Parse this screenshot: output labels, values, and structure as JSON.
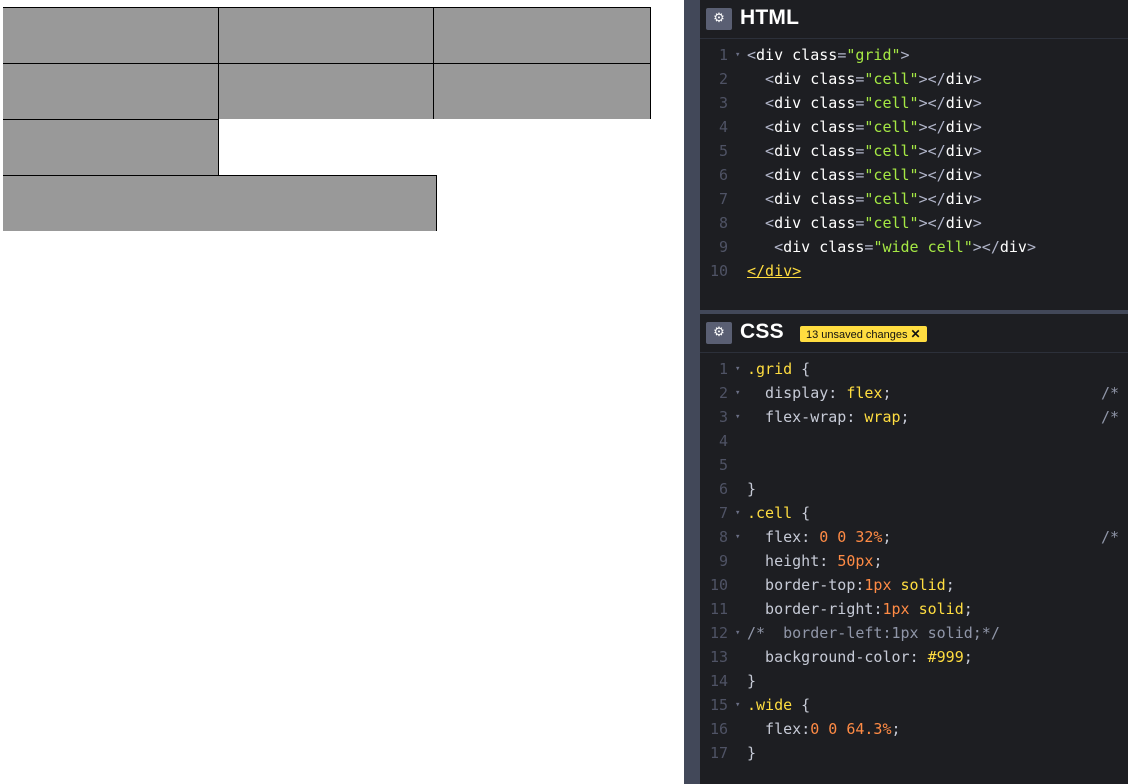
{
  "preview": {
    "rows": [
      [
        "",
        "",
        ""
      ],
      [
        "",
        "",
        ""
      ],
      [
        "",
        ""
      ]
    ]
  },
  "editors": {
    "html": {
      "title": "HTML",
      "lines": [
        {
          "n": "1",
          "fold": true,
          "tokens": [
            [
              "brk",
              "<"
            ],
            [
              "tag",
              "div "
            ],
            [
              "attr",
              "class"
            ],
            [
              "brk",
              "="
            ],
            [
              "str",
              "\"grid\""
            ],
            [
              "brk",
              ">"
            ]
          ]
        },
        {
          "n": "2",
          "tokens": [
            [
              "brk",
              "  <"
            ],
            [
              "tag",
              "div "
            ],
            [
              "attr",
              "class"
            ],
            [
              "brk",
              "="
            ],
            [
              "str",
              "\"cell\""
            ],
            [
              "brk",
              "></"
            ],
            [
              "tag",
              "div"
            ],
            [
              "brk",
              ">"
            ]
          ]
        },
        {
          "n": "3",
          "tokens": [
            [
              "brk",
              "  <"
            ],
            [
              "tag",
              "div "
            ],
            [
              "attr",
              "class"
            ],
            [
              "brk",
              "="
            ],
            [
              "str",
              "\"cell\""
            ],
            [
              "brk",
              "></"
            ],
            [
              "tag",
              "div"
            ],
            [
              "brk",
              ">"
            ]
          ]
        },
        {
          "n": "4",
          "tokens": [
            [
              "brk",
              "  <"
            ],
            [
              "tag",
              "div "
            ],
            [
              "attr",
              "class"
            ],
            [
              "brk",
              "="
            ],
            [
              "str",
              "\"cell\""
            ],
            [
              "brk",
              "></"
            ],
            [
              "tag",
              "div"
            ],
            [
              "brk",
              ">"
            ]
          ]
        },
        {
          "n": "5",
          "tokens": [
            [
              "brk",
              "  <"
            ],
            [
              "tag",
              "div "
            ],
            [
              "attr",
              "class"
            ],
            [
              "brk",
              "="
            ],
            [
              "str",
              "\"cell\""
            ],
            [
              "brk",
              "></"
            ],
            [
              "tag",
              "div"
            ],
            [
              "brk",
              ">"
            ]
          ]
        },
        {
          "n": "6",
          "tokens": [
            [
              "brk",
              "  <"
            ],
            [
              "tag",
              "div "
            ],
            [
              "attr",
              "class"
            ],
            [
              "brk",
              "="
            ],
            [
              "str",
              "\"cell\""
            ],
            [
              "brk",
              "></"
            ],
            [
              "tag",
              "div"
            ],
            [
              "brk",
              ">"
            ]
          ]
        },
        {
          "n": "7",
          "tokens": [
            [
              "brk",
              "  <"
            ],
            [
              "tag",
              "div "
            ],
            [
              "attr",
              "class"
            ],
            [
              "brk",
              "="
            ],
            [
              "str",
              "\"cell\""
            ],
            [
              "brk",
              "></"
            ],
            [
              "tag",
              "div"
            ],
            [
              "brk",
              ">"
            ]
          ]
        },
        {
          "n": "8",
          "tokens": [
            [
              "brk",
              "  <"
            ],
            [
              "tag",
              "div "
            ],
            [
              "attr",
              "class"
            ],
            [
              "brk",
              "="
            ],
            [
              "str",
              "\"cell\""
            ],
            [
              "brk",
              "></"
            ],
            [
              "tag",
              "div"
            ],
            [
              "brk",
              ">"
            ]
          ]
        },
        {
          "n": "9",
          "tokens": [
            [
              "brk",
              "   <"
            ],
            [
              "tag",
              "div "
            ],
            [
              "attr",
              "class"
            ],
            [
              "brk",
              "="
            ],
            [
              "str",
              "\"wide cell\""
            ],
            [
              "brk",
              "></"
            ],
            [
              "tag",
              "div"
            ],
            [
              "brk",
              ">"
            ]
          ]
        },
        {
          "n": "10",
          "tokens": [
            [
              "close",
              "</div>"
            ]
          ]
        }
      ]
    },
    "css": {
      "title": "CSS",
      "badge": "13 unsaved changes",
      "badge_close": "✕",
      "lines": [
        {
          "n": "1",
          "fold": true,
          "tokens": [
            [
              "selector",
              ".grid"
            ],
            [
              "prop",
              " {"
            ]
          ]
        },
        {
          "n": "2",
          "fold": true,
          "tokens": [
            [
              "prop",
              "  display"
            ],
            [
              "prop",
              ": "
            ],
            [
              "val",
              "flex"
            ],
            [
              "prop",
              ";"
            ]
          ],
          "trail": "/*"
        },
        {
          "n": "3",
          "fold": true,
          "tokens": [
            [
              "prop",
              "  flex-wrap"
            ],
            [
              "prop",
              ": "
            ],
            [
              "val",
              "wrap"
            ],
            [
              "prop",
              ";"
            ]
          ],
          "trail": "/*"
        },
        {
          "n": "4",
          "tokens": []
        },
        {
          "n": "5",
          "tokens": []
        },
        {
          "n": "6",
          "tokens": [
            [
              "prop",
              "}"
            ]
          ]
        },
        {
          "n": "7",
          "fold": true,
          "tokens": [
            [
              "selector",
              ".cell"
            ],
            [
              "prop",
              " {"
            ]
          ]
        },
        {
          "n": "8",
          "fold": true,
          "tokens": [
            [
              "prop",
              "  flex"
            ],
            [
              "prop",
              ": "
            ],
            [
              "num",
              "0 0 32%"
            ],
            [
              "prop",
              ";"
            ]
          ],
          "trail": "/*"
        },
        {
          "n": "9",
          "tokens": [
            [
              "prop",
              "  height"
            ],
            [
              "prop",
              ": "
            ],
            [
              "num",
              "50px"
            ],
            [
              "prop",
              ";"
            ]
          ]
        },
        {
          "n": "10",
          "tokens": [
            [
              "prop",
              "  border-top"
            ],
            [
              "prop",
              ":"
            ],
            [
              "num",
              "1px "
            ],
            [
              "val",
              "solid"
            ],
            [
              "prop",
              ";"
            ]
          ]
        },
        {
          "n": "11",
          "tokens": [
            [
              "prop",
              "  border-right"
            ],
            [
              "prop",
              ":"
            ],
            [
              "num",
              "1px "
            ],
            [
              "val",
              "solid"
            ],
            [
              "prop",
              ";"
            ]
          ]
        },
        {
          "n": "12",
          "fold": true,
          "tokens": [
            [
              "com",
              "/*  border-left:1px solid;*/"
            ]
          ]
        },
        {
          "n": "13",
          "tokens": [
            [
              "prop",
              "  background-color"
            ],
            [
              "prop",
              ": "
            ],
            [
              "val",
              "#999"
            ],
            [
              "prop",
              ";"
            ]
          ]
        },
        {
          "n": "14",
          "tokens": [
            [
              "prop",
              "}"
            ]
          ]
        },
        {
          "n": "15",
          "fold": true,
          "tokens": [
            [
              "selector",
              ".wide"
            ],
            [
              "prop",
              " {"
            ]
          ]
        },
        {
          "n": "16",
          "tokens": [
            [
              "prop",
              "  flex"
            ],
            [
              "prop",
              ":"
            ],
            [
              "num",
              "0 0 64.3%"
            ],
            [
              "prop",
              ";"
            ]
          ]
        },
        {
          "n": "17",
          "tokens": [
            [
              "prop",
              "}"
            ]
          ]
        }
      ]
    }
  }
}
